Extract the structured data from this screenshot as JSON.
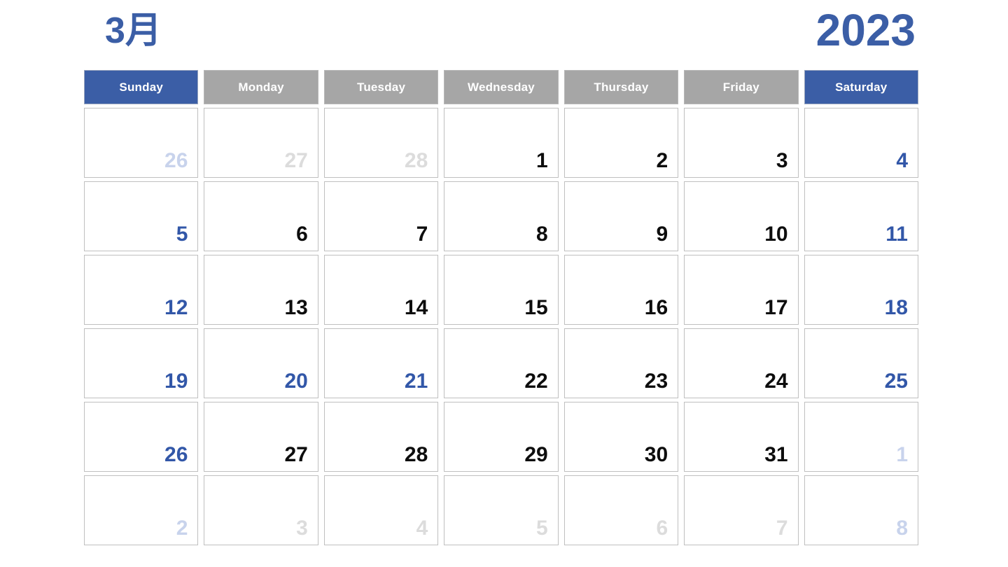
{
  "header": {
    "month_label": "3月",
    "year_label": "2023"
  },
  "colors": {
    "accent_blue": "#3B5EA6",
    "header_gray": "#A6A6A6",
    "date_blue": "#3257A8",
    "date_black": "#0D0D0D",
    "muted_gray": "#DCDCDC",
    "muted_blue": "#C8D3EC",
    "cell_border": "#BFBFBF"
  },
  "weekdays": [
    {
      "label": "Sunday",
      "style": "weekend"
    },
    {
      "label": "Monday",
      "style": "weekday"
    },
    {
      "label": "Tuesday",
      "style": "weekday"
    },
    {
      "label": "Wednesday",
      "style": "weekday"
    },
    {
      "label": "Thursday",
      "style": "weekday"
    },
    {
      "label": "Friday",
      "style": "weekday"
    },
    {
      "label": "Saturday",
      "style": "weekend"
    }
  ],
  "weeks": [
    [
      {
        "day": "26",
        "tone": "muted-blue"
      },
      {
        "day": "27",
        "tone": "muted-gray"
      },
      {
        "day": "28",
        "tone": "muted-gray"
      },
      {
        "day": "1",
        "tone": "black"
      },
      {
        "day": "2",
        "tone": "black"
      },
      {
        "day": "3",
        "tone": "black"
      },
      {
        "day": "4",
        "tone": "blue"
      }
    ],
    [
      {
        "day": "5",
        "tone": "blue"
      },
      {
        "day": "6",
        "tone": "black"
      },
      {
        "day": "7",
        "tone": "black"
      },
      {
        "day": "8",
        "tone": "black"
      },
      {
        "day": "9",
        "tone": "black"
      },
      {
        "day": "10",
        "tone": "black"
      },
      {
        "day": "11",
        "tone": "blue"
      }
    ],
    [
      {
        "day": "12",
        "tone": "blue"
      },
      {
        "day": "13",
        "tone": "black"
      },
      {
        "day": "14",
        "tone": "black"
      },
      {
        "day": "15",
        "tone": "black"
      },
      {
        "day": "16",
        "tone": "black"
      },
      {
        "day": "17",
        "tone": "black"
      },
      {
        "day": "18",
        "tone": "blue"
      }
    ],
    [
      {
        "day": "19",
        "tone": "blue"
      },
      {
        "day": "20",
        "tone": "blue"
      },
      {
        "day": "21",
        "tone": "blue"
      },
      {
        "day": "22",
        "tone": "black"
      },
      {
        "day": "23",
        "tone": "black"
      },
      {
        "day": "24",
        "tone": "black"
      },
      {
        "day": "25",
        "tone": "blue"
      }
    ],
    [
      {
        "day": "26",
        "tone": "blue"
      },
      {
        "day": "27",
        "tone": "black"
      },
      {
        "day": "28",
        "tone": "black"
      },
      {
        "day": "29",
        "tone": "black"
      },
      {
        "day": "30",
        "tone": "black"
      },
      {
        "day": "31",
        "tone": "black"
      },
      {
        "day": "1",
        "tone": "muted-blue"
      }
    ],
    [
      {
        "day": "2",
        "tone": "muted-blue"
      },
      {
        "day": "3",
        "tone": "muted-gray"
      },
      {
        "day": "4",
        "tone": "muted-gray"
      },
      {
        "day": "5",
        "tone": "muted-gray"
      },
      {
        "day": "6",
        "tone": "muted-gray"
      },
      {
        "day": "7",
        "tone": "muted-gray"
      },
      {
        "day": "8",
        "tone": "muted-blue"
      }
    ]
  ]
}
